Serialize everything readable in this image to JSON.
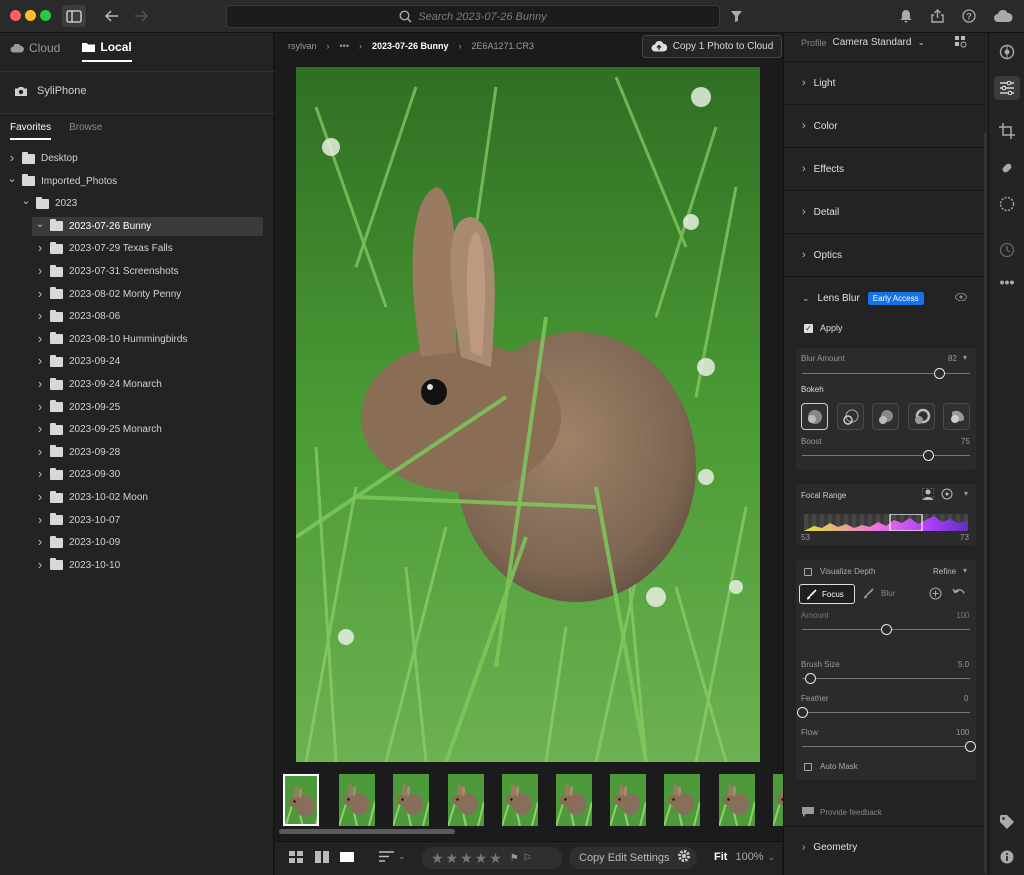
{
  "toolbar": {
    "search_placeholder": "Search 2023-07-26 Bunny",
    "icons": [
      "sidebar-toggle-icon",
      "back-arrow-icon",
      "forward-arrow-icon",
      "filter-icon",
      "bell-icon",
      "share-icon",
      "help-icon",
      "cloud-icon"
    ]
  },
  "left": {
    "tabs": [
      {
        "label": "Cloud"
      },
      {
        "label": "Local"
      }
    ],
    "device": "SyliPhone",
    "fav_tabs": [
      {
        "label": "Favorites"
      },
      {
        "label": "Browse"
      }
    ],
    "tree": [
      {
        "label": "Desktop",
        "depth": 0,
        "open": false,
        "selected": false
      },
      {
        "label": "Imported_Photos",
        "depth": 0,
        "open": true,
        "selected": false
      },
      {
        "label": "2023",
        "depth": 1,
        "open": true,
        "selected": false
      },
      {
        "label": "2023-07-26 Bunny",
        "depth": 2,
        "open": true,
        "selected": true
      },
      {
        "label": "2023-07-29 Texas Falls",
        "depth": 2,
        "open": false,
        "selected": false
      },
      {
        "label": "2023-07-31 Screenshots",
        "depth": 2,
        "open": false,
        "selected": false
      },
      {
        "label": "2023-08-02 Monty Penny",
        "depth": 2,
        "open": false,
        "selected": false
      },
      {
        "label": "2023-08-06",
        "depth": 2,
        "open": false,
        "selected": false
      },
      {
        "label": "2023-08-10 Hummingbirds",
        "depth": 2,
        "open": false,
        "selected": false
      },
      {
        "label": "2023-09-24",
        "depth": 2,
        "open": false,
        "selected": false
      },
      {
        "label": "2023-09-24 Monarch",
        "depth": 2,
        "open": false,
        "selected": false
      },
      {
        "label": "2023-09-25",
        "depth": 2,
        "open": false,
        "selected": false
      },
      {
        "label": "2023-09-25 Monarch",
        "depth": 2,
        "open": false,
        "selected": false
      },
      {
        "label": "2023-09-28",
        "depth": 2,
        "open": false,
        "selected": false
      },
      {
        "label": "2023-09-30",
        "depth": 2,
        "open": false,
        "selected": false
      },
      {
        "label": "2023-10-02 Moon",
        "depth": 2,
        "open": false,
        "selected": false
      },
      {
        "label": "2023-10-07",
        "depth": 2,
        "open": false,
        "selected": false
      },
      {
        "label": "2023-10-09",
        "depth": 2,
        "open": false,
        "selected": false
      },
      {
        "label": "2023-10-10",
        "depth": 2,
        "open": false,
        "selected": false
      }
    ]
  },
  "center": {
    "breadcrumbs": [
      "rsylvan",
      "•••",
      "2023-07-26 Bunny",
      "2E6A1271.CR3"
    ],
    "copy_button": "Copy 1 Photo to Cloud",
    "filmstrip_count": 10,
    "bottom": {
      "copy_edit": "Copy Edit Settings",
      "fit": "Fit",
      "zoom": "100%",
      "stars": "★★★★★"
    }
  },
  "right": {
    "profile_label": "Profile",
    "profile_value": "Camera Standard",
    "sections": [
      "Light",
      "Color",
      "Effects",
      "Detail",
      "Optics"
    ],
    "lens_blur": {
      "title": "Lens Blur",
      "badge": "Early Access",
      "apply": "Apply",
      "blur_amount_label": "Blur Amount",
      "blur_amount": "82",
      "blur_amount_level": 0.82,
      "bokeh_label": "Bokeh",
      "boost_label": "Boost",
      "boost": "75",
      "boost_level": 0.75,
      "focal_range_label": "Focal Range",
      "focal_min": "53",
      "focal_max": "73",
      "visualize_depth": "Visualize Depth",
      "refine": "Refine",
      "focus": "Focus",
      "blur": "Blur",
      "amount_label": "Amount",
      "amount": "100",
      "amount_level": 0.5,
      "brush_size_label": "Brush Size",
      "brush_size": "5.0",
      "brush_size_level": 0.05,
      "feather_label": "Feather",
      "feather": "0",
      "feather_level": 0.0,
      "flow_label": "Flow",
      "flow": "100",
      "flow_level": 1.0,
      "auto_mask": "Auto Mask"
    },
    "feedback": "Provide feedback",
    "geometry": "Geometry"
  },
  "colors": {
    "accent": "#1473e6",
    "traffic_red": "#fe5f57",
    "traffic_yellow": "#febc2e",
    "traffic_green": "#28c840"
  }
}
